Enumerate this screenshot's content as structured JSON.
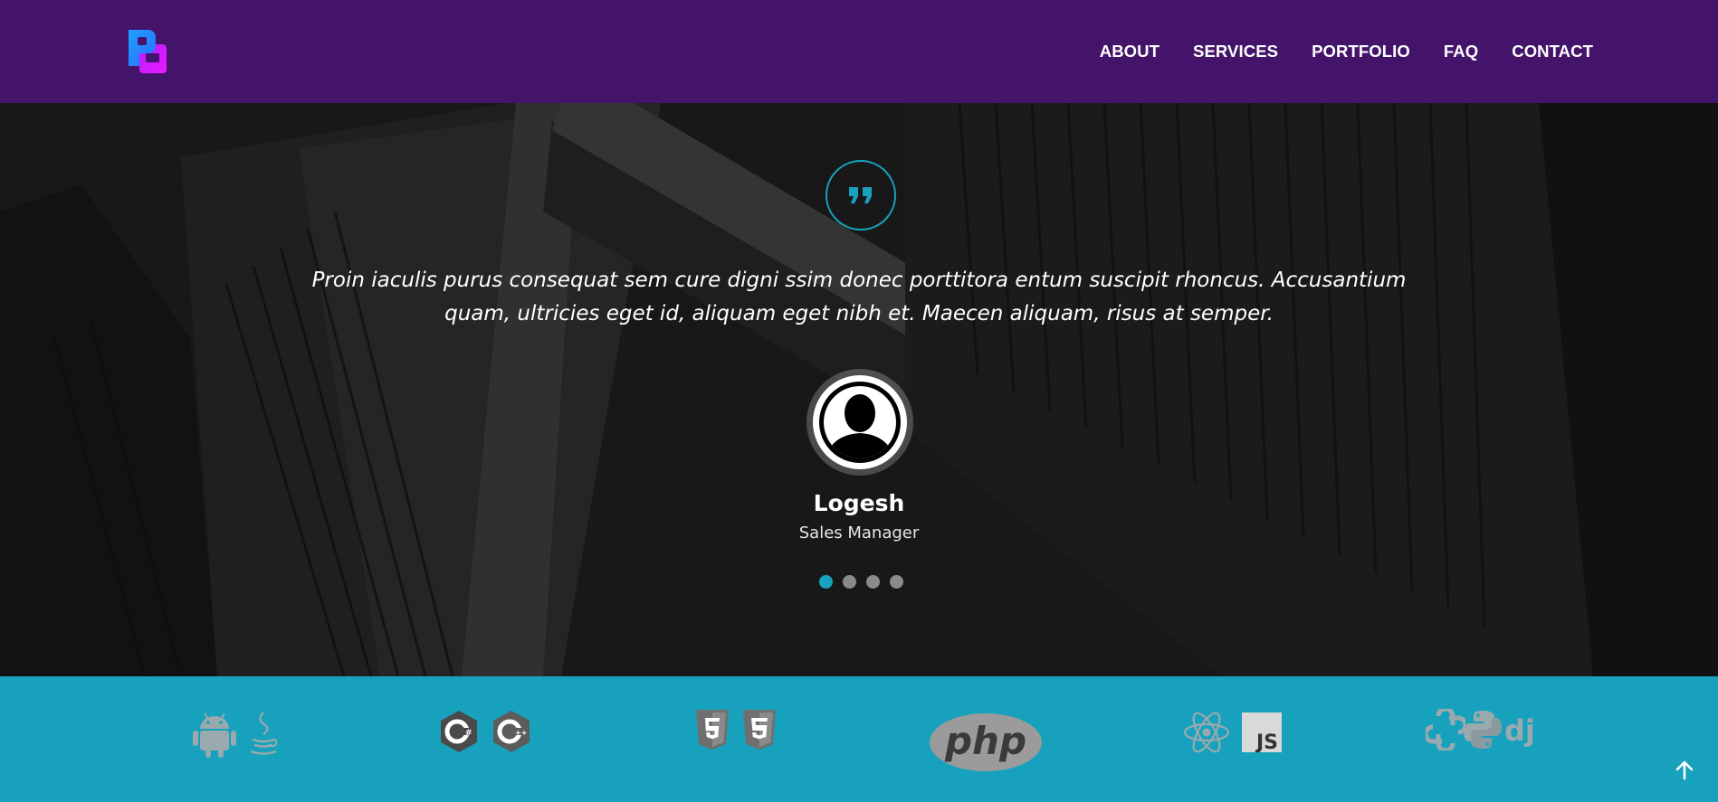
{
  "nav": {
    "items": [
      "ABOUT",
      "SERVICES",
      "PORTFOLIO",
      "FAQ",
      "CONTACT"
    ]
  },
  "testimonial": {
    "quote": "Proin iaculis purus consequat sem cure digni ssim donec porttitora entum suscipit rhoncus. Accusantium quam, ultricies eget id, aliquam eget nibh et. Maecen aliquam, risus at semper.",
    "name": "Logesh",
    "role": "Sales Manager",
    "slide_count": 4,
    "active_slide": 1
  },
  "tech_icons": {
    "php_label": "php",
    "js_label": "JS",
    "django_label": "dj",
    "icons": [
      "android-icon",
      "java-icon",
      "csharp-icon",
      "cplusplus-icon",
      "html5-icon",
      "css3-icon",
      "php-icon",
      "react-icon",
      "javascript-icon",
      "python-icon",
      "django-icon"
    ]
  },
  "colors": {
    "header_bg": "#43146a",
    "accent": "#17a2bf",
    "techbar_bg": "#18a1bd"
  },
  "icons": {
    "logo": "logo-icon",
    "quote": "quote-icon",
    "avatar": "user-avatar-icon",
    "back_to_top": "arrow-up-icon"
  }
}
